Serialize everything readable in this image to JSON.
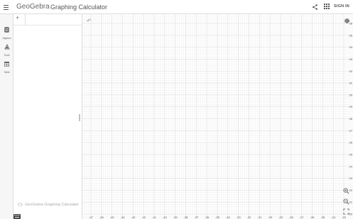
{
  "header": {
    "logo": "GeoGebra",
    "title": "Graphing Calculator",
    "signin_label": "SIGN IN"
  },
  "sidebar": {
    "items": [
      {
        "label": "Algebra"
      },
      {
        "label": "Tools"
      },
      {
        "label": "Table"
      }
    ]
  },
  "algebra": {
    "footer_brand": "GeoGebra Graphing Calculator"
  },
  "graph": {
    "y_ticks": [
      "36",
      "35",
      "34",
      "33",
      "32",
      "31",
      "30",
      "29",
      "28",
      "27",
      "26",
      "25",
      "24",
      "23",
      "22",
      "21",
      "20"
    ],
    "x_ticks": [
      "-47",
      "-46",
      "-45",
      "-44",
      "-43",
      "-42",
      "-41",
      "-40",
      "-39",
      "-38",
      "-37",
      "-36",
      "-35",
      "-34",
      "-33",
      "-32",
      "-31",
      "-30",
      "-29",
      "-28",
      "-27",
      "-26",
      "-25",
      "-24",
      "-23"
    ]
  }
}
